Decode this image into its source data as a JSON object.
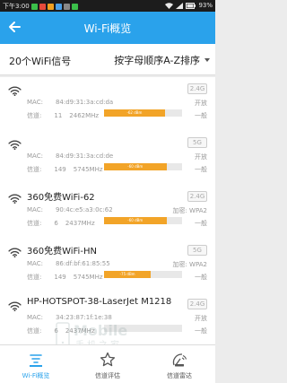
{
  "status_bar": {
    "time": "下午3:00",
    "battery": "93%"
  },
  "app_bar": {
    "title": "Wi-Fi概览"
  },
  "list_header": {
    "count_label": "20个WiFi信号",
    "sort_label": "按字母顺序A-Z排序"
  },
  "networks": [
    {
      "name": "",
      "mac_label": "MAC:",
      "mac": "84:d9:31:3a:cd:da",
      "channel_label": "信道:",
      "channel": "11",
      "freq": "2462MHz",
      "band": "2.4G",
      "security": "开放",
      "level": "一般",
      "signal_text": "-62 dBm",
      "signal_fraction": 0.78
    },
    {
      "name": "",
      "mac_label": "MAC:",
      "mac": "84:d9:31:3a:cd:de",
      "channel_label": "信道:",
      "channel": "149",
      "freq": "5745MHz",
      "band": "5G",
      "security": "开放",
      "level": "一般",
      "signal_text": "-60 dBm",
      "signal_fraction": 0.8
    },
    {
      "name": "360免费WiFi-62",
      "mac_label": "MAC:",
      "mac": "90:4c:e5:a3:0c:62",
      "channel_label": "信道:",
      "channel": "6",
      "freq": "2437MHz",
      "band": "2.4G",
      "security": "加密: WPA2",
      "level": "一般",
      "signal_text": "-60 dBm",
      "signal_fraction": 0.8
    },
    {
      "name": "360免费WiFi-HN",
      "mac_label": "MAC:",
      "mac": "86:df:bf:61:85:55",
      "channel_label": "信道:",
      "channel": "149",
      "freq": "5745MHz",
      "band": "5G",
      "security": "加密: WPA2",
      "level": "一般",
      "signal_text": "-75 dBm",
      "signal_fraction": 0.6
    },
    {
      "name": "HP-HOTSPOT-38-LaserJet M1218",
      "mac_label": "MAC:",
      "mac": "34:23:87:1f:1e:38",
      "channel_label": "信道:",
      "channel": "6",
      "freq": "2437MHz",
      "band": "2.4G",
      "security": "开放",
      "level": "一般",
      "signal_text": "",
      "signal_fraction": 0.0
    }
  ],
  "tabs": [
    {
      "label": "Wi-Fi概览",
      "icon": "wifi-overview-icon",
      "active": true
    },
    {
      "label": "信道评估",
      "icon": "star-icon",
      "active": false
    },
    {
      "label": "信道雷达",
      "icon": "radar-icon",
      "active": false
    }
  ],
  "watermark": {
    "line1": "Mobile",
    "line2": "手机之家"
  },
  "colors": {
    "primary": "#2aa2eb",
    "signal_bar": "#f2a428"
  }
}
